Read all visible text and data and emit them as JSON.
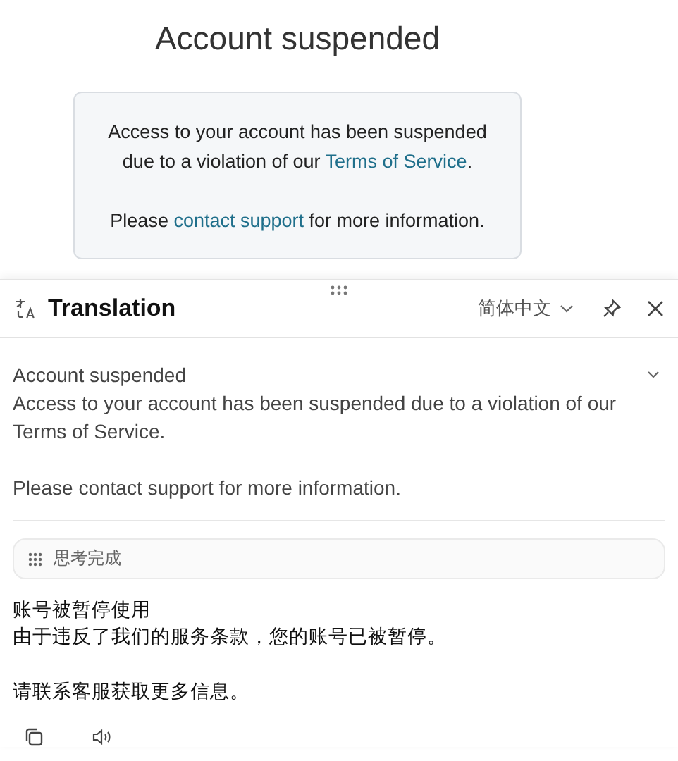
{
  "page": {
    "title": "Account suspended",
    "notice": [
      {
        "before": "Access to your account has been suspended due to a violation of our ",
        "link": "Terms of Service",
        "after": "."
      },
      {
        "before": "Please ",
        "link": "contact support",
        "after": " for more information."
      }
    ]
  },
  "panel": {
    "title": "Translation",
    "language": "简体中文",
    "source": {
      "heading": "Account suspended",
      "lines": [
        "Access to your account has been suspended due to a violation of our Terms of Service.",
        "Please contact support for more information."
      ]
    },
    "status": "思考完成",
    "result": {
      "heading": "账号被暂停使用",
      "lines": [
        "由于违反了我们的服务条款，您的账号已被暂停。",
        "请联系客服获取更多信息。"
      ]
    }
  }
}
